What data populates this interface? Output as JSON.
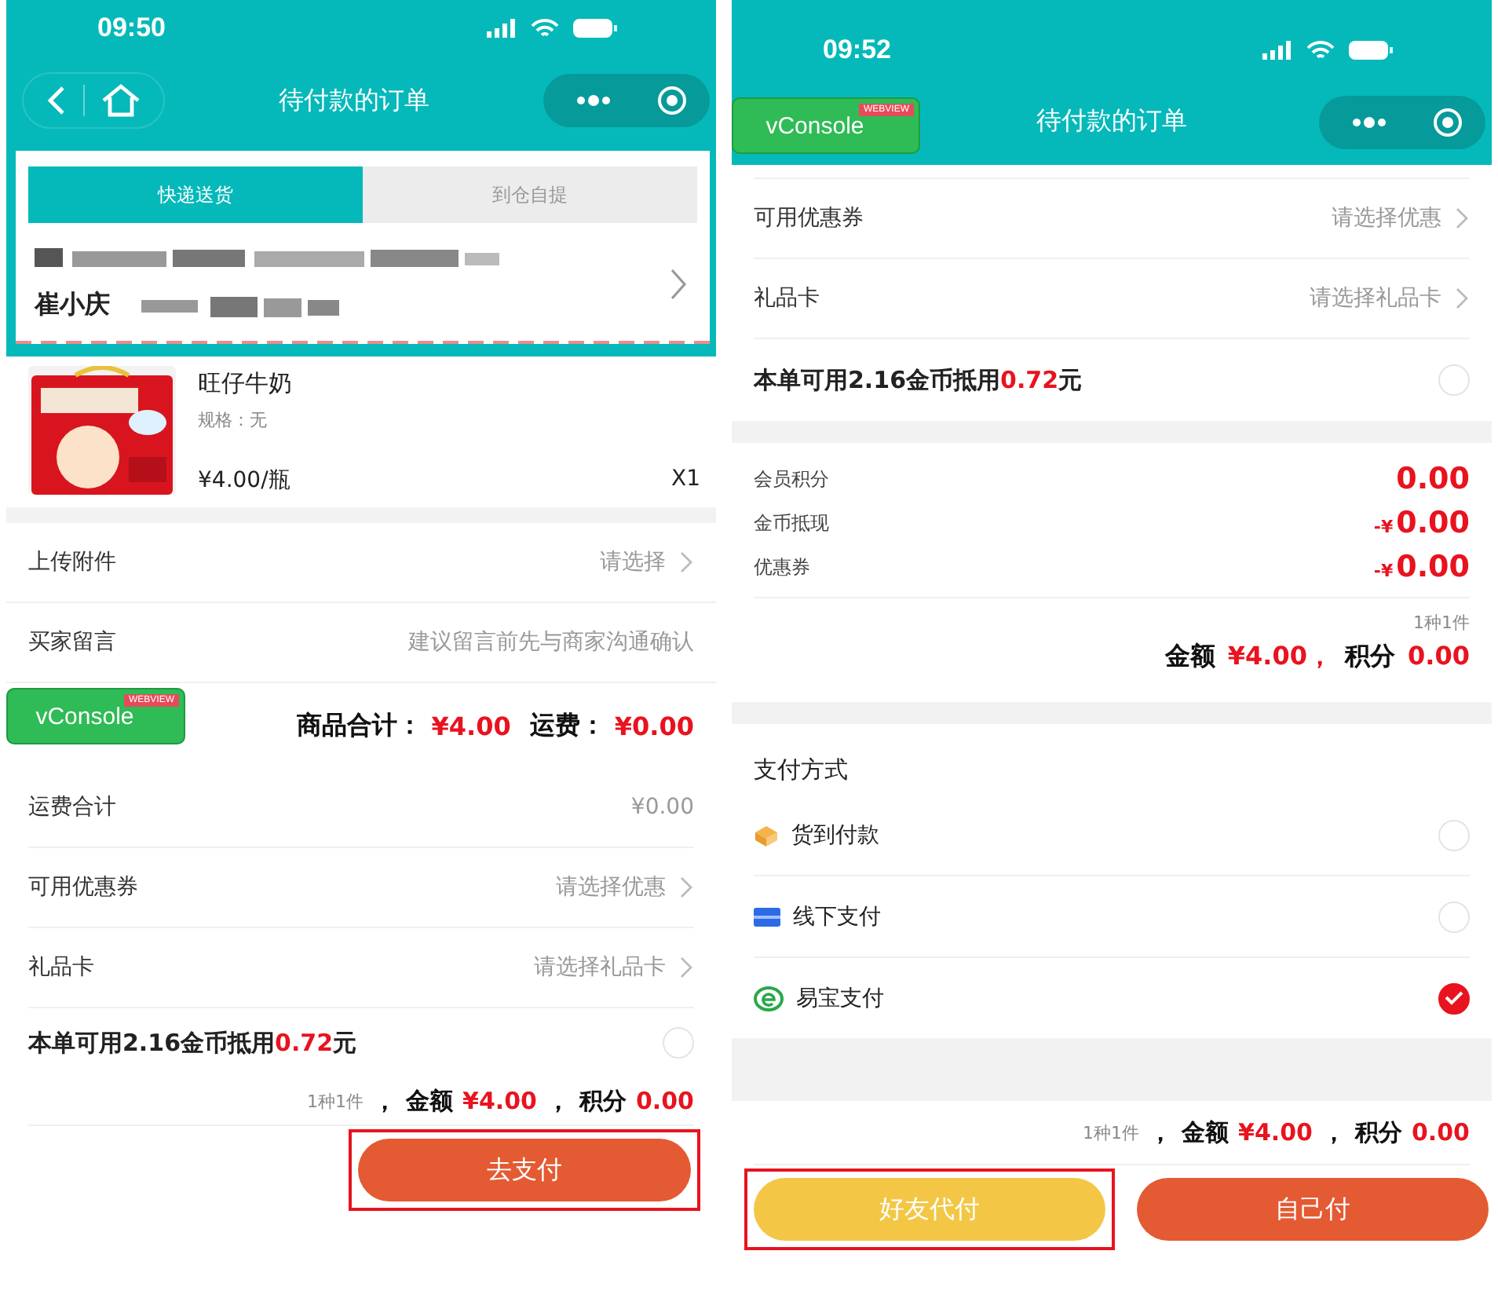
{
  "left_screen": {
    "status_bar": {
      "time": "09:50"
    },
    "nav": {
      "title": "待付款的订单"
    },
    "delivery_tabs": [
      {
        "label": "快递送货",
        "selected": true
      },
      {
        "label": "到仓自提",
        "selected": false
      }
    ],
    "address": {
      "name": "崔小庆"
    },
    "product": {
      "name": "旺仔牛奶",
      "spec": "规格：无",
      "price": "¥4.00/瓶",
      "quantity": "X1"
    },
    "rows_top": [
      {
        "kind": "select",
        "label": "上传附件",
        "value": "请选择"
      },
      {
        "kind": "input",
        "label": "买家留言",
        "placeholder": "建议留言前先与商家沟通确认"
      }
    ],
    "subtotal": {
      "goods_label": "商品合计：",
      "goods_amount": "¥4.00",
      "shipping_label": "运费：",
      "shipping_amount": "¥0.00"
    },
    "rows_bottom": [
      {
        "kind": "value",
        "label": "运费合计",
        "value": "¥0.00"
      },
      {
        "kind": "select",
        "label": "可用优惠券",
        "value": "请选择优惠"
      },
      {
        "kind": "select",
        "label": "礼品卡",
        "value": "请选择礼品卡"
      }
    ],
    "coin_offer": {
      "before": "本单可用2.16金币抵用",
      "amount": "0.72",
      "after": "元",
      "checked": false
    },
    "summary": {
      "count": "1种1件",
      "sep1": "，",
      "amount_label": "金额",
      "amount": "¥4.00",
      "sep2": "，",
      "points_label": "积分",
      "points": "0.00"
    },
    "buttons": [
      {
        "kind": "pay",
        "label": "去支付",
        "highlighted": true
      }
    ],
    "vconsole": {
      "label": "vConsole",
      "ribbon": "WEBVIEW"
    }
  },
  "right_screen": {
    "status_bar": {
      "time": "09:52"
    },
    "nav": {
      "title": "待付款的订单"
    },
    "rows": [
      {
        "kind": "select",
        "label": "可用优惠券",
        "value": "请选择优惠"
      },
      {
        "kind": "select",
        "label": "礼品卡",
        "value": "请选择礼品卡"
      }
    ],
    "coin_offer": {
      "before": "本单可用2.16金币抵用",
      "amount": "0.72",
      "after": "元",
      "checked": false
    },
    "details": [
      {
        "label": "会员积分",
        "value": "0.00"
      },
      {
        "label": "金币抵现",
        "prefix": "-¥",
        "value": "0.00"
      },
      {
        "label": "优惠券",
        "prefix": "-¥",
        "value": "0.00"
      }
    ],
    "totals": {
      "count": "1种1件",
      "amount_label": "金额",
      "amount": "¥4.00，",
      "points_label": "积分",
      "points": "0.00"
    },
    "payment": {
      "title": "支付方式",
      "methods": [
        {
          "kind": "cod",
          "label": "货到付款",
          "selected": false
        },
        {
          "kind": "offline",
          "label": "线下支付",
          "selected": false
        },
        {
          "kind": "yeepay",
          "label": "易宝支付",
          "selected": true
        }
      ]
    },
    "summary": {
      "count": "1种1件",
      "sep1": "，",
      "amount_label": "金额",
      "amount": "¥4.00",
      "sep2": "，",
      "points_label": "积分",
      "points": "0.00"
    },
    "buttons": [
      {
        "kind": "friend",
        "label": "好友代付",
        "highlighted": true
      },
      {
        "kind": "self",
        "label": "自己付",
        "highlighted": false
      }
    ],
    "vconsole": {
      "label": "vConsole",
      "ribbon": "WEBVIEW"
    }
  }
}
